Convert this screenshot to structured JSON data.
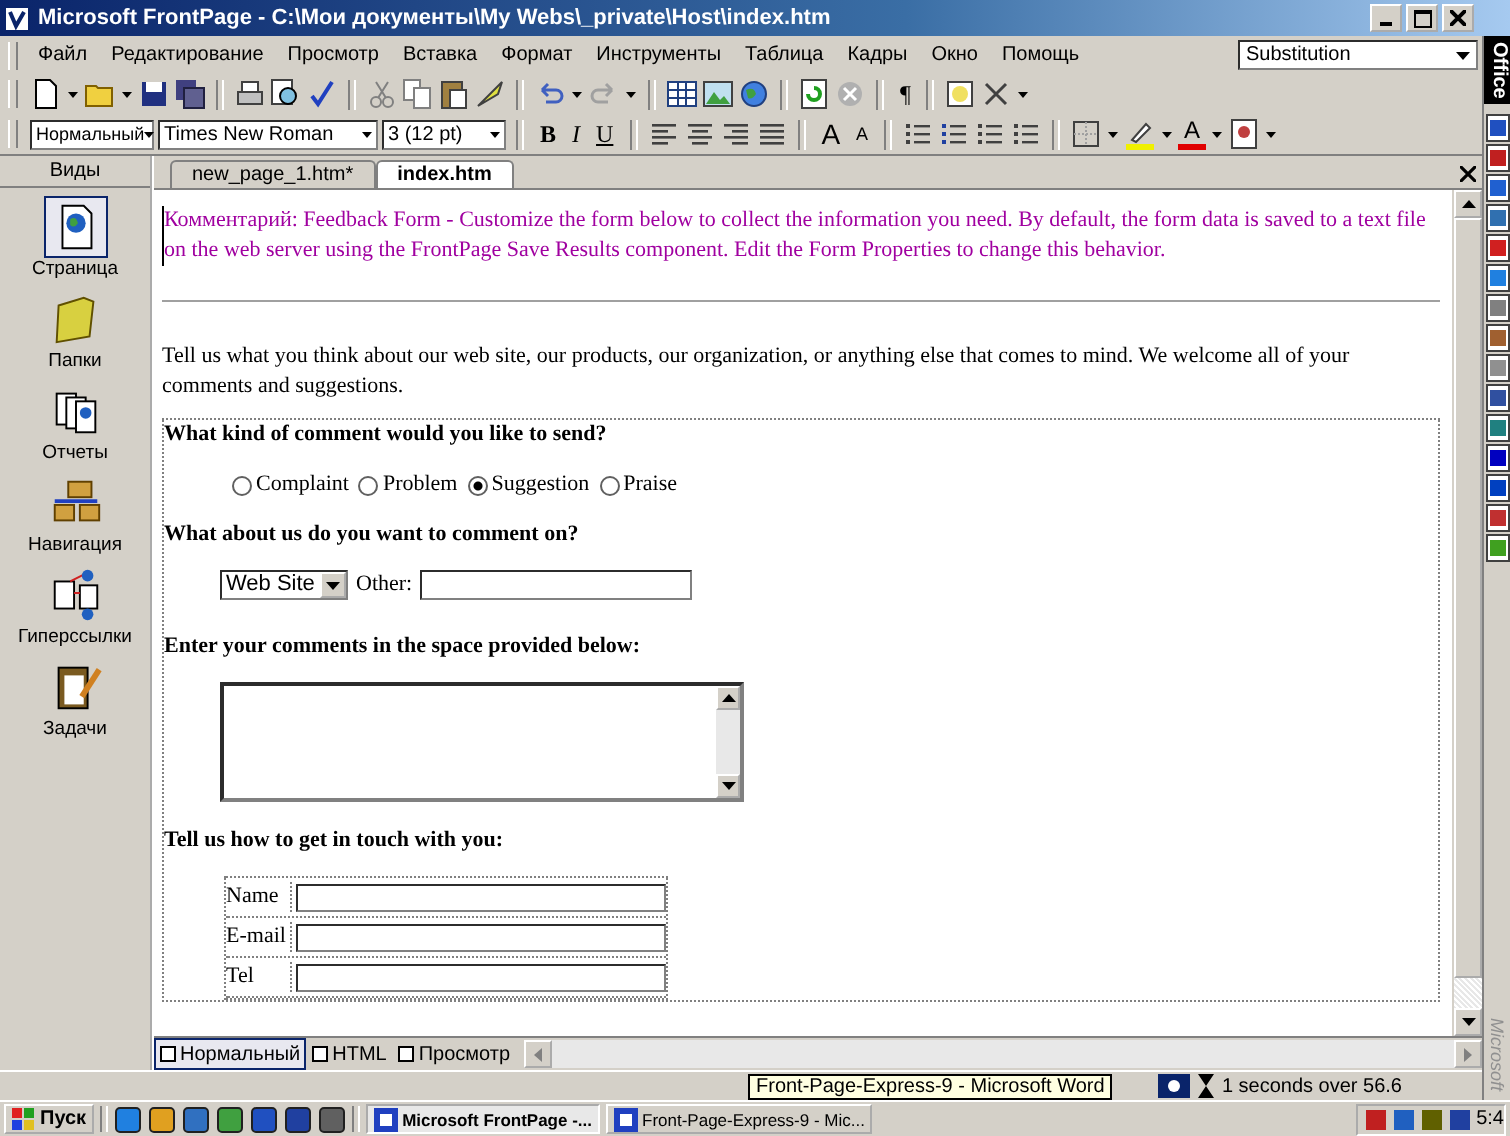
{
  "window": {
    "title": "Microsoft FrontPage - C:\\Мои документы\\My Webs\\_private\\Host\\index.htm"
  },
  "menu": [
    "Файл",
    "Редактирование",
    "Просмотр",
    "Вставка",
    "Формат",
    "Инструменты",
    "Таблица",
    "Кадры",
    "Окно",
    "Помощь"
  ],
  "substitution": {
    "value": "Substitution"
  },
  "standard_toolbar": {
    "pilcrow": "¶"
  },
  "format_toolbar": {
    "style": "Нормальный",
    "font": "Times New Roman",
    "size": "3 (12 pt)",
    "bold": "B",
    "italic": "I",
    "underline": "U",
    "grow": "A",
    "shrink": "A",
    "font_color": "A"
  },
  "views": {
    "title": "Виды",
    "items": [
      {
        "label": "Страница",
        "kind": "page",
        "selected": true
      },
      {
        "label": "Папки",
        "kind": "folders",
        "selected": false
      },
      {
        "label": "Отчеты",
        "kind": "reports",
        "selected": false
      },
      {
        "label": "Навигация",
        "kind": "navigation",
        "selected": false
      },
      {
        "label": "Гиперссылки",
        "kind": "hyperlinks",
        "selected": false
      },
      {
        "label": "Задачи",
        "kind": "tasks",
        "selected": false
      }
    ]
  },
  "tabs": [
    {
      "label": "new_page_1.htm*",
      "selected": false
    },
    {
      "label": "index.htm",
      "selected": true
    }
  ],
  "document": {
    "comment": "Комментарий: Feedback Form - Customize the form below to collect the information you need. By default, the form data is saved to a text file on the web server using the FrontPage Save Results component. Edit the Form Properties to change this behavior.",
    "intro": "Tell us what you think about our web site, our products, our organization, or anything else that comes to mind. We welcome all of your comments and suggestions.",
    "q1": "What kind of comment would you like to send?",
    "radios": [
      {
        "label": "Complaint",
        "selected": false
      },
      {
        "label": "Problem",
        "selected": false
      },
      {
        "label": "Suggestion",
        "selected": true
      },
      {
        "label": "Praise",
        "selected": false
      }
    ],
    "q2": "What about us do you want to comment on?",
    "subject": {
      "value": "Web Site"
    },
    "other_label": "Other:",
    "q3": "Enter your comments in the space provided below:",
    "q4": "Tell us how to get in touch with you:",
    "contact_fields": [
      {
        "label": "Name"
      },
      {
        "label": "E-mail"
      },
      {
        "label": "Tel"
      }
    ]
  },
  "view_tabs": [
    {
      "label": "Нормальный",
      "selected": true
    },
    {
      "label": "HTML",
      "selected": false
    },
    {
      "label": "Просмотр",
      "selected": false
    }
  ],
  "status": {
    "text": "1 seconds over 56.6"
  },
  "tooltip": "Front-Page-Express-9 - Microsoft Word",
  "taskbar": {
    "start": "Пуск",
    "tasks": [
      {
        "label": "Microsoft FrontPage -...",
        "selected": true
      },
      {
        "label": "Front-Page-Express-9 - Mic...",
        "selected": false
      }
    ],
    "clock": "5:4"
  },
  "office_bar": {
    "title": "Office",
    "footer": "Microsoft"
  }
}
